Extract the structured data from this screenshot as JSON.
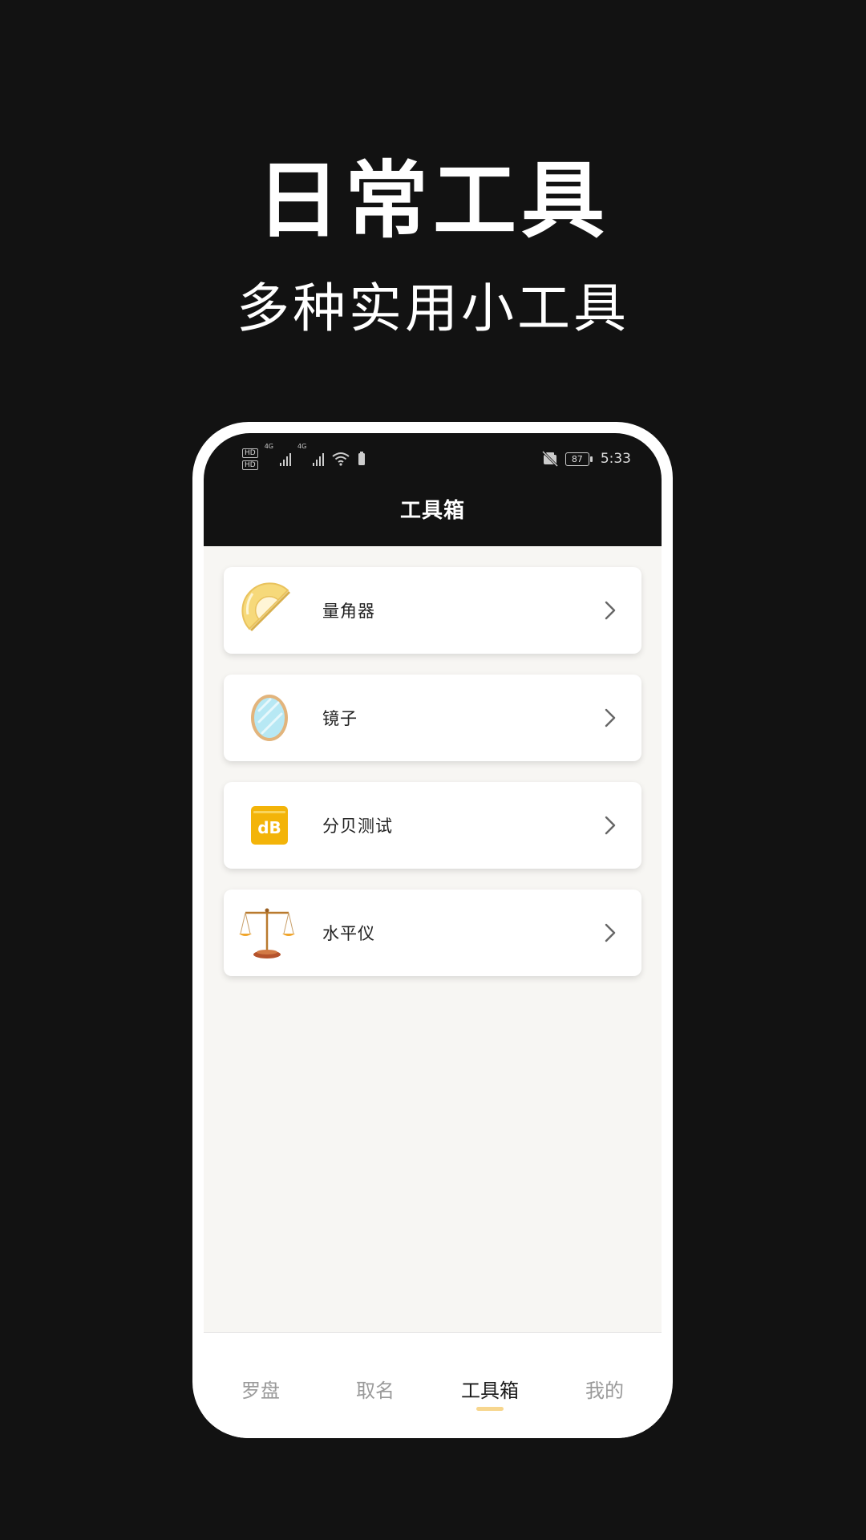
{
  "promo": {
    "title": "日常工具",
    "subtitle": "多种实用小工具"
  },
  "status_bar": {
    "hd_labels": [
      "HD",
      "HD"
    ],
    "network_labels": [
      "4G",
      "4G"
    ],
    "battery_level": "87",
    "time": "5:33"
  },
  "header": {
    "title": "工具箱"
  },
  "tools": [
    {
      "label": "量角器",
      "icon": "protractor-icon"
    },
    {
      "label": "镜子",
      "icon": "mirror-icon"
    },
    {
      "label": "分贝测试",
      "icon": "decibel-icon",
      "icon_text": "dB"
    },
    {
      "label": "水平仪",
      "icon": "balance-scale-icon"
    }
  ],
  "tabs": [
    {
      "label": "罗盘",
      "active": false
    },
    {
      "label": "取名",
      "active": false
    },
    {
      "label": "工具箱",
      "active": true
    },
    {
      "label": "我的",
      "active": false
    }
  ],
  "colors": {
    "background": "#121212",
    "header": "#121212",
    "content_bg": "#f7f6f3",
    "tab_indicator": "#f7d68e",
    "decibel_icon": "#f3b409"
  }
}
